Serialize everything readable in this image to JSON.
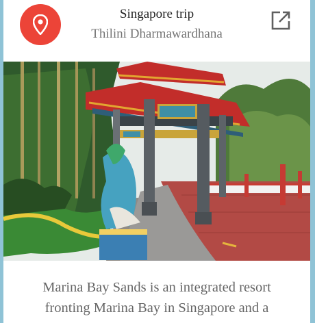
{
  "card": {
    "title": "Singapore trip",
    "author": "Thilini Dharmawardhana",
    "description": "Marina Bay Sands is an integrated resort fronting Marina Bay in Singapore and a"
  },
  "icons": {
    "avatar": "map-pin-icon",
    "action": "open-in-new-icon"
  },
  "colors": {
    "avatar_bg": "#ec4438",
    "page_bg": "#8fc3d6",
    "title": "#222222",
    "subtitle": "#757575",
    "body_text": "#666666"
  }
}
